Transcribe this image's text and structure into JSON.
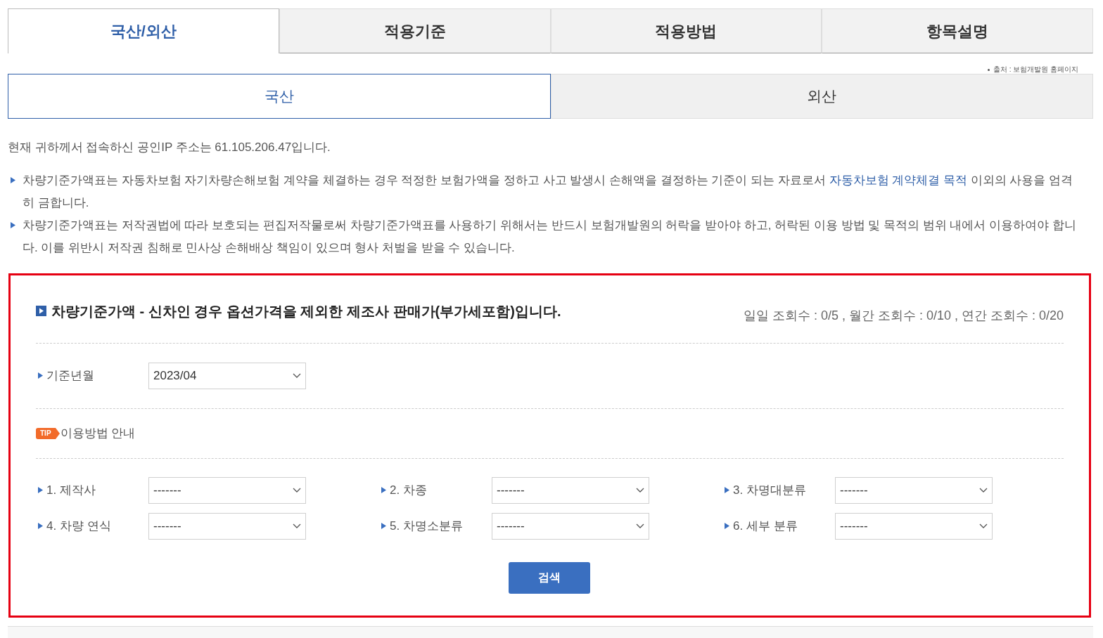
{
  "main_tabs": [
    {
      "label": "국산/외산",
      "selected": true
    },
    {
      "label": "적용기준",
      "selected": false
    },
    {
      "label": "적용방법",
      "selected": false
    },
    {
      "label": "항목설명",
      "selected": false
    }
  ],
  "source_note": "출처 : 보험개발원 홈페이지",
  "sub_tabs": [
    {
      "label": "국산",
      "selected": true
    },
    {
      "label": "외산",
      "selected": false
    }
  ],
  "ip_notice": "현재 귀하께서 접속하신 공인IP 주소는 61.105.206.47입니다.",
  "notices": [
    {
      "before": "차량기준가액표는 자동차보험 자기차량손해보험 계약을 체결하는 경우 적정한 보험가액을 정하고 사고 발생시 손해액을 결정하는 기준이 되는 자료로서 ",
      "link": "자동차보험 계약체결 목적",
      "after": " 이외의 사용을 엄격히 금합니다."
    },
    {
      "before": "차량기준가액표는 저작권법에 따라 보호되는 편집저작물로써 차량기준가액표를 사용하기 위해서는 반드시 보험개발원의 허락을 받아야 하고, 허락된 이용 방법 및 목적의 범위 내에서 이용하여야 합니다. 이를 위반시 저작권 침해로 민사상 손해배상 책임이 있으며 형사 처벌을 받을 수 있습니다."
    }
  ],
  "panel": {
    "title": "차량기준가액 - 신차인 경우 옵션가격을 제외한 제조사 판매가(부가세포함)입니다.",
    "counts": "일일 조회수 : 0/5 , 월간 조회수 : 0/10 , 연간 조회수 : 0/20",
    "base_month": {
      "label": "기준년월",
      "value": "2023/04"
    },
    "tip": {
      "badge": "TIP",
      "label": "이용방법 안내"
    },
    "filters": [
      {
        "label": "1. 제작사",
        "value": "-------"
      },
      {
        "label": "2. 차종",
        "value": "-------"
      },
      {
        "label": "3. 차명대분류",
        "value": "-------"
      },
      {
        "label": "4. 차량 연식",
        "value": "-------"
      },
      {
        "label": "5. 차명소분류",
        "value": "-------"
      },
      {
        "label": "6. 세부 분류",
        "value": "-------"
      }
    ],
    "search_button": "검색"
  }
}
